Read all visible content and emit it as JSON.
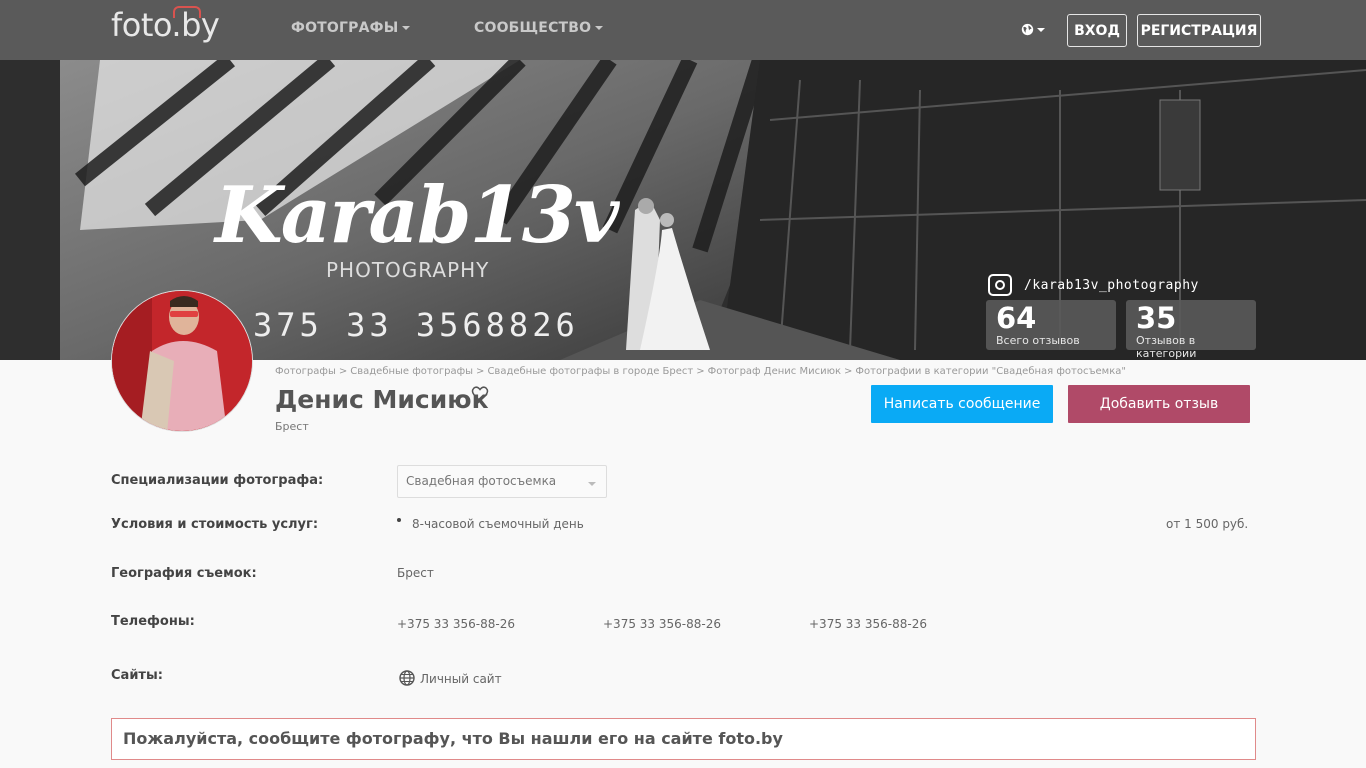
{
  "nav": {
    "logo": "foto.by",
    "menu": [
      {
        "label": "ФОТОГРАФЫ"
      },
      {
        "label": "СООБЩЕСТВО"
      }
    ],
    "login_label": "ВХОД",
    "register_label": "РЕГИСТРАЦИЯ",
    "language_icon": "globe-icon"
  },
  "cover": {
    "brand_title": "Karab13v",
    "brand_subtitle": "PHOTOGRAPHY",
    "brand_phone": "375 33 3568826",
    "instagram_handle": "/karab13v_photography",
    "stats": [
      {
        "value": "64",
        "label": "Всего отзывов"
      },
      {
        "value": "35",
        "label": "Отзывов в категории"
      }
    ]
  },
  "profile": {
    "breadcrumb": [
      "Фотографы",
      "Свадебные фотографы",
      "Свадебные фотографы в городе Брест",
      "Фотограф Денис Мисиюк",
      "Фотографии в категории \"Свадебная фотосъемка\""
    ],
    "breadcrumb_separator": ">",
    "name": "Денис Мисиюк",
    "city": "Брест",
    "message_button": "Написать сообщение",
    "review_button": "Добавить отзыв"
  },
  "details": {
    "specialization_label": "Специализации фотографа:",
    "specialization_value": "Свадебная фотосъемка",
    "conditions_label": "Условия и стоимость услуг:",
    "condition_item": "8-часовой съемочный день",
    "condition_price": "от 1 500 руб.",
    "geography_label": "География съемок:",
    "geography_value": "Брест",
    "phones_label": "Телефоны:",
    "phones": [
      "+375 33 356-88-26",
      "+375 33 356-88-26",
      "+375 33 356-88-26"
    ],
    "sites_label": "Сайты:",
    "site_link": "Личный сайт"
  },
  "notice": "Пожалуйста, сообщите фотографу, что Вы нашли его на сайте foto.by",
  "colors": {
    "nav_bg": "#5a5a5a",
    "message_button": "#0aaaf5",
    "review_button": "#b04a68",
    "notice_border": "#e08a8a"
  }
}
